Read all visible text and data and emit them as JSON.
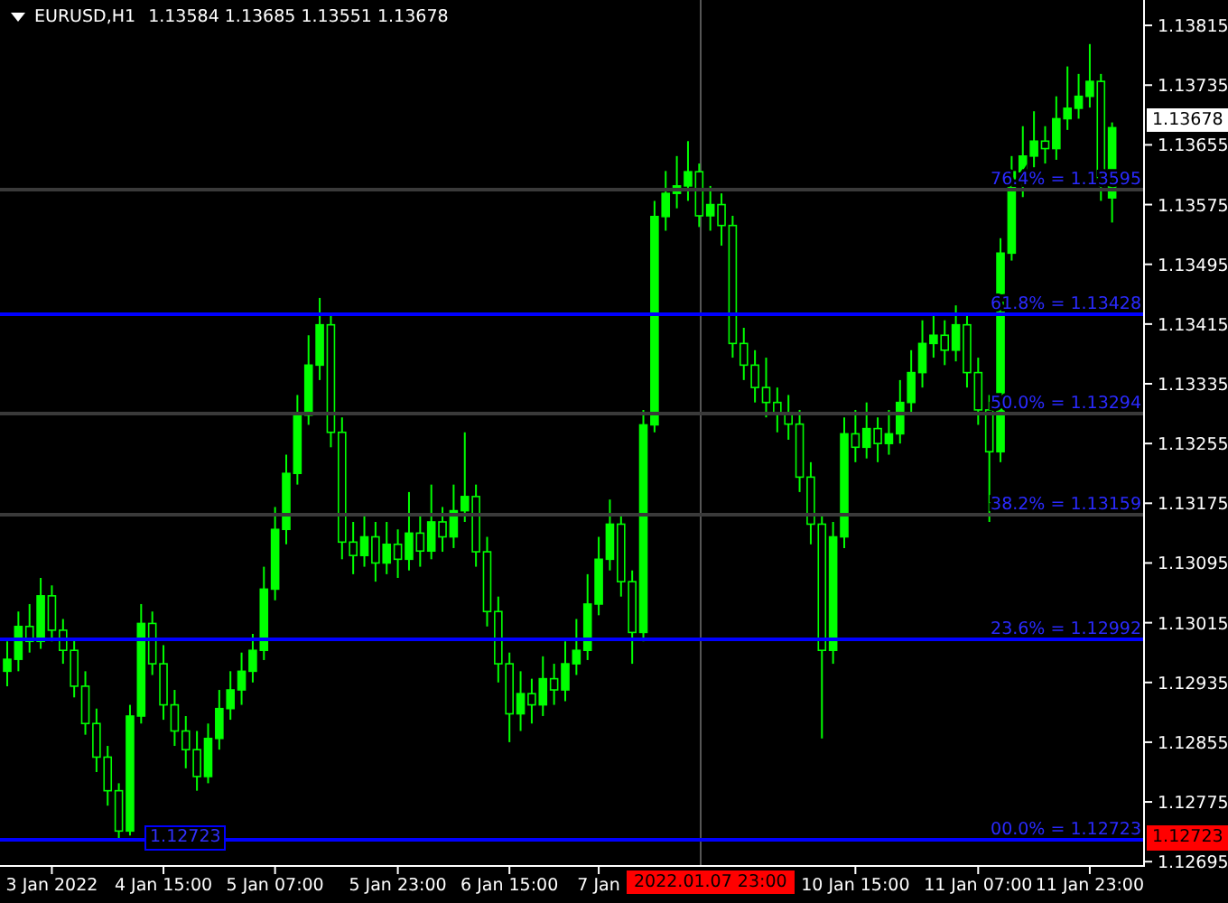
{
  "header": {
    "symbol": "EURUSD,H1",
    "quote": "1.13584 1.13685 1.13551 1.13678"
  },
  "chart_data": {
    "type": "candlestick",
    "ylim": [
      1.12688,
      1.13849
    ],
    "yticks": [
      {
        "value": 1.13815,
        "label": "1.13815"
      },
      {
        "value": 1.13735,
        "label": "1.13735"
      },
      {
        "value": 1.13655,
        "label": "1.13655"
      },
      {
        "value": 1.13575,
        "label": "1.13575"
      },
      {
        "value": 1.13495,
        "label": "1.13495"
      },
      {
        "value": 1.13415,
        "label": "1.13415"
      },
      {
        "value": 1.13335,
        "label": "1.13335"
      },
      {
        "value": 1.13255,
        "label": "1.13255"
      },
      {
        "value": 1.13175,
        "label": "1.13175"
      },
      {
        "value": 1.13095,
        "label": "1.13095"
      },
      {
        "value": 1.13015,
        "label": "1.13015"
      },
      {
        "value": 1.12935,
        "label": "1.12935"
      },
      {
        "value": 1.12855,
        "label": "1.12855"
      },
      {
        "value": 1.12775,
        "label": "1.12775"
      },
      {
        "value": 1.12695,
        "label": "1.12695"
      }
    ],
    "categories": [
      null,
      null,
      null,
      null,
      "3 Jan 2022",
      null,
      null,
      null,
      null,
      null,
      null,
      null,
      null,
      null,
      "4 Jan 15:00",
      null,
      null,
      null,
      null,
      null,
      null,
      null,
      null,
      null,
      "5 Jan 07:00",
      null,
      null,
      null,
      null,
      null,
      null,
      null,
      null,
      null,
      null,
      "5 Jan 23:00",
      null,
      null,
      null,
      null,
      null,
      null,
      null,
      null,
      null,
      "6 Jan 15:00",
      null,
      null,
      null,
      null,
      null,
      null,
      null,
      "7 Jan",
      null,
      null,
      null,
      null,
      null,
      null,
      null,
      null,
      null,
      null,
      null,
      null,
      null,
      null,
      null,
      null,
      null,
      null,
      null,
      null,
      null,
      null,
      "10 Jan 15:00",
      null,
      null,
      null,
      null,
      null,
      null,
      null,
      null,
      null,
      null,
      "11 Jan 07:00",
      null,
      null,
      null,
      null,
      null,
      null,
      null,
      null,
      null,
      "11 Jan 23:00",
      null,
      null
    ],
    "ohlc": [
      [
        1.1295,
        1.1299,
        1.1293,
        1.12966
      ],
      [
        1.12966,
        1.1303,
        1.1295,
        1.1301
      ],
      [
        1.1301,
        1.1304,
        1.12975,
        1.1299
      ],
      [
        1.1299,
        1.13075,
        1.1298,
        1.13051
      ],
      [
        1.13051,
        1.13065,
        1.1299,
        1.13005
      ],
      [
        1.13005,
        1.1302,
        1.1296,
        1.12978
      ],
      [
        1.12978,
        1.12995,
        1.12915,
        1.1293
      ],
      [
        1.1293,
        1.1295,
        1.12865,
        1.1288
      ],
      [
        1.1288,
        1.129,
        1.12815,
        1.12835
      ],
      [
        1.12835,
        1.1285,
        1.1277,
        1.1279
      ],
      [
        1.1279,
        1.128,
        1.12723,
        1.12736
      ],
      [
        1.12736,
        1.12905,
        1.1273,
        1.1289
      ],
      [
        1.1289,
        1.1304,
        1.1288,
        1.13014
      ],
      [
        1.13014,
        1.1303,
        1.12945,
        1.1296
      ],
      [
        1.1296,
        1.12985,
        1.12885,
        1.12905
      ],
      [
        1.12905,
        1.12925,
        1.1285,
        1.1287
      ],
      [
        1.1287,
        1.1289,
        1.1282,
        1.12845
      ],
      [
        1.12845,
        1.1287,
        1.1279,
        1.12809
      ],
      [
        1.12809,
        1.1288,
        1.128,
        1.1286
      ],
      [
        1.1286,
        1.12925,
        1.12845,
        1.129
      ],
      [
        1.129,
        1.1295,
        1.12885,
        1.12925
      ],
      [
        1.12925,
        1.12975,
        1.12905,
        1.1295
      ],
      [
        1.1295,
        1.13,
        1.12935,
        1.12978
      ],
      [
        1.12978,
        1.1309,
        1.12965,
        1.1306
      ],
      [
        1.1306,
        1.1317,
        1.13045,
        1.1314
      ],
      [
        1.1314,
        1.1324,
        1.1312,
        1.13215
      ],
      [
        1.13215,
        1.1332,
        1.132,
        1.13293
      ],
      [
        1.13293,
        1.134,
        1.1328,
        1.1336
      ],
      [
        1.1336,
        1.1345,
        1.1334,
        1.13414
      ],
      [
        1.13414,
        1.1343,
        1.1325,
        1.1327
      ],
      [
        1.1327,
        1.1329,
        1.131,
        1.13123
      ],
      [
        1.13123,
        1.1315,
        1.1308,
        1.13105
      ],
      [
        1.13105,
        1.1316,
        1.1309,
        1.1313
      ],
      [
        1.1313,
        1.1315,
        1.1307,
        1.13095
      ],
      [
        1.13095,
        1.1315,
        1.1308,
        1.1312
      ],
      [
        1.1312,
        1.1314,
        1.13075,
        1.131
      ],
      [
        1.131,
        1.1319,
        1.13085,
        1.13135
      ],
      [
        1.13135,
        1.1316,
        1.1309,
        1.13111
      ],
      [
        1.13111,
        1.132,
        1.131,
        1.1315
      ],
      [
        1.1315,
        1.1317,
        1.1311,
        1.1313
      ],
      [
        1.1313,
        1.132,
        1.13115,
        1.13165
      ],
      [
        1.13165,
        1.1327,
        1.1315,
        1.13184
      ],
      [
        1.13184,
        1.132,
        1.1309,
        1.1311
      ],
      [
        1.1311,
        1.1313,
        1.1301,
        1.1303
      ],
      [
        1.1303,
        1.1305,
        1.12935,
        1.1296
      ],
      [
        1.1296,
        1.12975,
        1.12855,
        1.12893
      ],
      [
        1.12893,
        1.1295,
        1.1287,
        1.1292
      ],
      [
        1.1292,
        1.1294,
        1.1288,
        1.12905
      ],
      [
        1.12905,
        1.1297,
        1.1289,
        1.1294
      ],
      [
        1.1294,
        1.1296,
        1.12905,
        1.12925
      ],
      [
        1.12925,
        1.1299,
        1.1291,
        1.1296
      ],
      [
        1.1296,
        1.1302,
        1.12945,
        1.12978
      ],
      [
        1.12978,
        1.1308,
        1.12965,
        1.1304
      ],
      [
        1.1304,
        1.1313,
        1.13025,
        1.131
      ],
      [
        1.131,
        1.1318,
        1.13085,
        1.13147
      ],
      [
        1.13147,
        1.1316,
        1.1305,
        1.1307
      ],
      [
        1.1307,
        1.13085,
        1.1296,
        1.13002
      ],
      [
        1.13002,
        1.133,
        1.1299,
        1.1328
      ],
      [
        1.1328,
        1.1358,
        1.1327,
        1.13559
      ],
      [
        1.13559,
        1.1362,
        1.1354,
        1.1359
      ],
      [
        1.1359,
        1.1364,
        1.1357,
        1.136
      ],
      [
        1.136,
        1.1366,
        1.1358,
        1.13619
      ],
      [
        1.13619,
        1.1363,
        1.13545,
        1.1356
      ],
      [
        1.1356,
        1.136,
        1.1354,
        1.13575
      ],
      [
        1.13575,
        1.1359,
        1.1352,
        1.13547
      ],
      [
        1.13547,
        1.1356,
        1.1337,
        1.13389
      ],
      [
        1.13389,
        1.1341,
        1.1334,
        1.1336
      ],
      [
        1.1336,
        1.1338,
        1.1331,
        1.1333
      ],
      [
        1.1333,
        1.1337,
        1.1329,
        1.1331
      ],
      [
        1.1331,
        1.1333,
        1.1327,
        1.13295
      ],
      [
        1.13295,
        1.1332,
        1.1326,
        1.13281
      ],
      [
        1.13281,
        1.133,
        1.1319,
        1.1321
      ],
      [
        1.1321,
        1.1323,
        1.1312,
        1.13147
      ],
      [
        1.13147,
        1.1316,
        1.1286,
        1.12978
      ],
      [
        1.12978,
        1.1315,
        1.1296,
        1.1313
      ],
      [
        1.1313,
        1.1329,
        1.13115,
        1.13268
      ],
      [
        1.13268,
        1.133,
        1.1323,
        1.1325
      ],
      [
        1.1325,
        1.1331,
        1.13235,
        1.13275
      ],
      [
        1.13275,
        1.1329,
        1.1323,
        1.13255
      ],
      [
        1.13255,
        1.133,
        1.1324,
        1.13268
      ],
      [
        1.13268,
        1.1334,
        1.13255,
        1.1331
      ],
      [
        1.1331,
        1.1338,
        1.13295,
        1.1335
      ],
      [
        1.1335,
        1.1342,
        1.1333,
        1.13389
      ],
      [
        1.13389,
        1.1343,
        1.1337,
        1.134
      ],
      [
        1.134,
        1.1342,
        1.1336,
        1.1338
      ],
      [
        1.1338,
        1.1344,
        1.13365,
        1.13414
      ],
      [
        1.13414,
        1.1343,
        1.1333,
        1.1335
      ],
      [
        1.1335,
        1.1337,
        1.1328,
        1.133
      ],
      [
        1.133,
        1.1332,
        1.1315,
        1.13244
      ],
      [
        1.13244,
        1.1353,
        1.1323,
        1.1351
      ],
      [
        1.1351,
        1.1364,
        1.135,
        1.13619
      ],
      [
        1.13619,
        1.1368,
        1.13585,
        1.1364
      ],
      [
        1.1364,
        1.137,
        1.13625,
        1.1366
      ],
      [
        1.1366,
        1.1368,
        1.1363,
        1.1365
      ],
      [
        1.1365,
        1.1372,
        1.13635,
        1.1369
      ],
      [
        1.1369,
        1.1376,
        1.13675,
        1.13704
      ],
      [
        1.13704,
        1.1375,
        1.1369,
        1.1372
      ],
      [
        1.1372,
        1.1379,
        1.13705,
        1.1374
      ],
      [
        1.1374,
        1.1375,
        1.1358,
        1.136
      ],
      [
        1.13584,
        1.13685,
        1.13551,
        1.13678
      ]
    ]
  },
  "fib_levels": [
    {
      "label": "76.4% = 1.13595",
      "highlighted": false
    },
    {
      "label": "61.8% = 1.13428",
      "highlighted": true
    },
    {
      "label": "50.0% = 1.13294",
      "highlighted": false
    },
    {
      "label": "38.2% = 1.13159",
      "highlighted": false
    },
    {
      "label": "23.6% = 1.12992",
      "highlighted": true
    },
    {
      "label": "00.0% = 1.12723",
      "highlighted": true
    }
  ],
  "current_price": "1.13678",
  "low_price_tag": "1.12723",
  "crosshair_time": "2022.01.07 23:00",
  "low_marker": "1.12723"
}
